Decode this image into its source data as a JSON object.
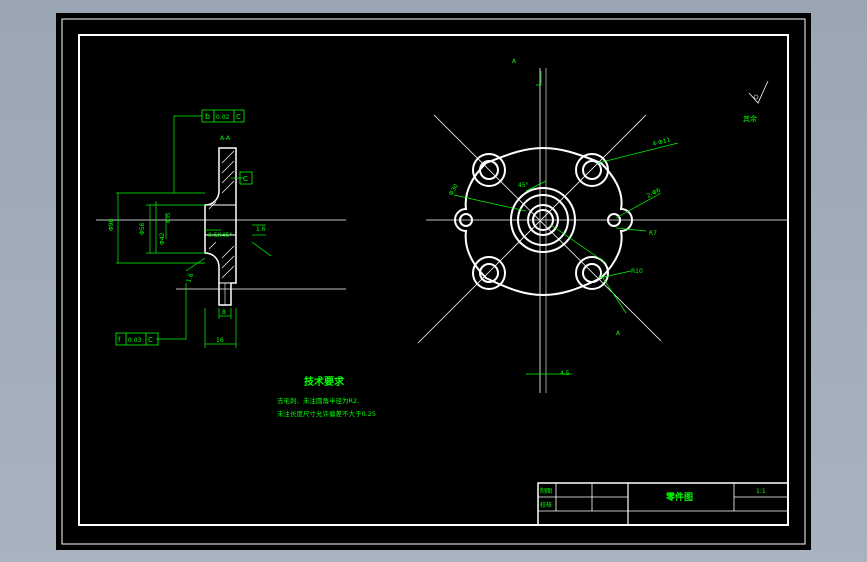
{
  "colors": {
    "background": "#9aa6b4",
    "sheet": "#000000",
    "outline": "#ffffff",
    "annotation": "#00ff00"
  },
  "section": {
    "label": "A-A",
    "tolerance_top": {
      "symbol": "b",
      "value": "0.02",
      "datum": "C"
    },
    "datum_box": "C",
    "tolerance_bottom": {
      "symbol": "f",
      "value": "0.03",
      "datum": "C"
    },
    "dim_d1": "Φ98",
    "dim_d2": "Φ56",
    "dim_d3": "Φ42",
    "dim_d4": "Φ35",
    "dim_chamfer": "0.5X45°",
    "dim_r": "1.6",
    "dim_t1": "8",
    "dim_t2": "16",
    "dim_left_r": "1.6"
  },
  "plan": {
    "center_mark": "A",
    "bottom_mark": "A",
    "holes_label": "4-Φ11",
    "thread_label": "2-Φ6",
    "r_label": "R7",
    "r_label2": "R10",
    "bore_label": "Φ30",
    "angle_label": "45°",
    "width_label": "4.5"
  },
  "surface": {
    "note": "其余"
  },
  "notes": {
    "title": "技术要求",
    "lines": [
      "去毛刺、未注圆角半径为R2.",
      "未注长度尺寸允许偏差不大于0.25"
    ]
  },
  "title_block": {
    "drawn_label": "制图",
    "checked_label": "校核",
    "part_name": "零件图",
    "scale": "1:1"
  }
}
